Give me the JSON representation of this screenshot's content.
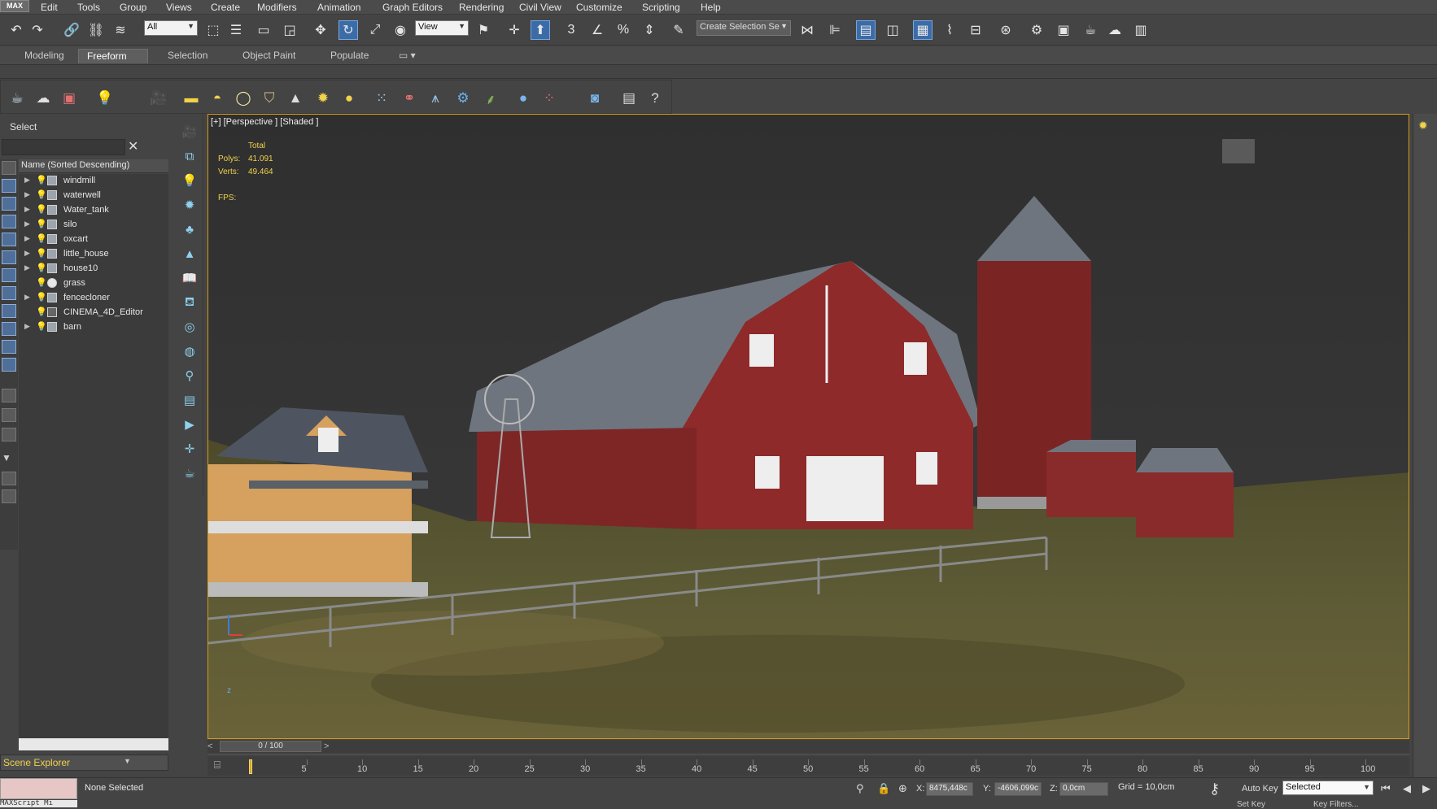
{
  "app": {
    "logo": "MAX"
  },
  "menu": [
    "Edit",
    "Tools",
    "Group",
    "Views",
    "Create",
    "Modifiers",
    "Animation",
    "Graph Editors",
    "Rendering",
    "Civil View",
    "Customize",
    "Scripting",
    "Help"
  ],
  "toolbar": {
    "filter_value": "All",
    "refcoord_value": "View",
    "selection_set_value": "Create Selection Se",
    "snap_label": "3",
    "icons": [
      "undo-icon",
      "redo-icon",
      "link-icon",
      "unlink-icon",
      "bind-spacewarp-icon",
      "select-object-icon",
      "select-by-name-icon",
      "rect-region-icon",
      "window-crossing-icon",
      "move-icon",
      "rotate-icon",
      "scale-icon",
      "place-icon",
      "pivot-icon",
      "keyboard-shortcut-icon",
      "snap-icon",
      "angle-snap-icon",
      "percent-snap-icon",
      "spinner-snap-icon",
      "edit-named-sets-icon",
      "mirror-icon",
      "align-icon",
      "scene-explorer-icon",
      "layer-explorer-icon",
      "toggle-ribbon-icon",
      "curve-editor-icon",
      "schematic-view-icon",
      "material-editor-icon",
      "render-setup-icon",
      "rendered-frame-icon",
      "render-icon",
      "render-online-icon",
      "a360-icon"
    ]
  },
  "ribbon": {
    "tabs": [
      "Modeling",
      "Freeform",
      "Selection",
      "Object Paint",
      "Populate"
    ],
    "active": "Freeform"
  },
  "scene_explorer": {
    "title": "Select",
    "column_header": "Name (Sorted Descending)",
    "footer_label": "Scene Explorer",
    "items": [
      {
        "name": "windmill",
        "expandable": true
      },
      {
        "name": "waterwell",
        "expandable": true
      },
      {
        "name": "Water_tank",
        "expandable": true
      },
      {
        "name": "silo",
        "expandable": true
      },
      {
        "name": "oxcart",
        "expandable": true
      },
      {
        "name": "little_house",
        "expandable": true
      },
      {
        "name": "house10",
        "expandable": true
      },
      {
        "name": "grass",
        "expandable": false
      },
      {
        "name": "fencecloner",
        "expandable": true
      },
      {
        "name": "CINEMA_4D_Editor",
        "expandable": false
      },
      {
        "name": "barn",
        "expandable": true
      }
    ]
  },
  "viewport": {
    "label": "[+] [Perspective ] [Shaded ]",
    "stats": {
      "total_label": "Total",
      "polys_label": "Polys:",
      "polys_value": "41.091",
      "verts_label": "Verts:",
      "verts_value": "49.464",
      "fps_label": "FPS:"
    },
    "axis_label": "z",
    "border_color": "#d69a1c"
  },
  "timeline": {
    "range_label": "0 / 100",
    "prev": "<",
    "next": ">",
    "ticks": [
      5,
      10,
      15,
      20,
      25,
      30,
      35,
      40,
      45,
      50,
      55,
      60,
      65,
      70,
      75,
      80,
      85,
      90,
      95,
      100
    ],
    "current_frame": 0
  },
  "status": {
    "listener_text": "MAXScript Mi",
    "selection_text": "None Selected",
    "x_label": "X:",
    "x_value": "8475,448c",
    "y_label": "Y:",
    "y_value": "-4606,099c",
    "z_label": "Z:",
    "z_value": "0,0cm",
    "grid_text": "Grid = 10,0cm",
    "autokey_label": "Auto Key",
    "selected_value": "Selected",
    "setkey_label": "Set Key",
    "keyfilters_label": "Key Filters..."
  },
  "colors": {
    "accent": "#3c6ca8",
    "active_border": "#d69a1c",
    "stat_text": "#f1d24c"
  }
}
